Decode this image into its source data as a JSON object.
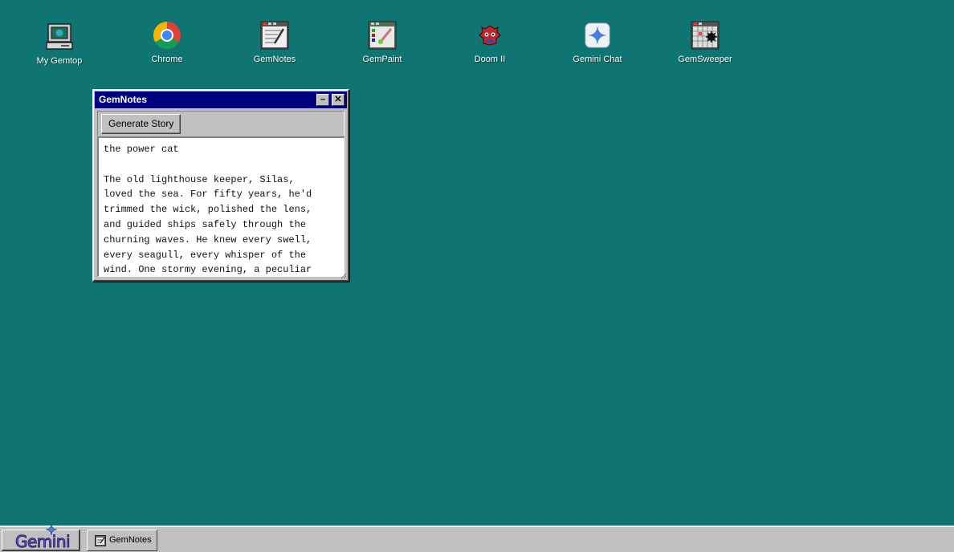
{
  "desktop": {
    "icons": [
      {
        "label": "My Gemtop",
        "icon": "computer-icon"
      },
      {
        "label": "Chrome",
        "icon": "chrome-icon"
      },
      {
        "label": "GemNotes",
        "icon": "notepad-icon"
      },
      {
        "label": "GemPaint",
        "icon": "paint-icon"
      },
      {
        "label": "Doom II",
        "icon": "doom-icon"
      },
      {
        "label": "Gemini Chat",
        "icon": "gemini-chat-icon"
      },
      {
        "label": "GemSweeper",
        "icon": "minesweeper-icon"
      }
    ],
    "background_color": "#0f7573"
  },
  "window": {
    "title": "GemNotes",
    "minimize_label": "–",
    "close_label": "✕",
    "generate_button_label": "Generate Story",
    "content": "the power cat\n\nThe old lighthouse keeper, Silas,\nloved the sea. For fifty years, he'd\ntrimmed the wick, polished the lens,\nand guided ships safely through the\nchurning waves. He knew every swell,\nevery seagull, every whisper of the\nwind. One stormy evening, a peculiar"
  },
  "taskbar": {
    "start_label": "Gemini",
    "tasks": [
      {
        "label": "GemNotes",
        "icon": "notepad-icon"
      }
    ]
  }
}
